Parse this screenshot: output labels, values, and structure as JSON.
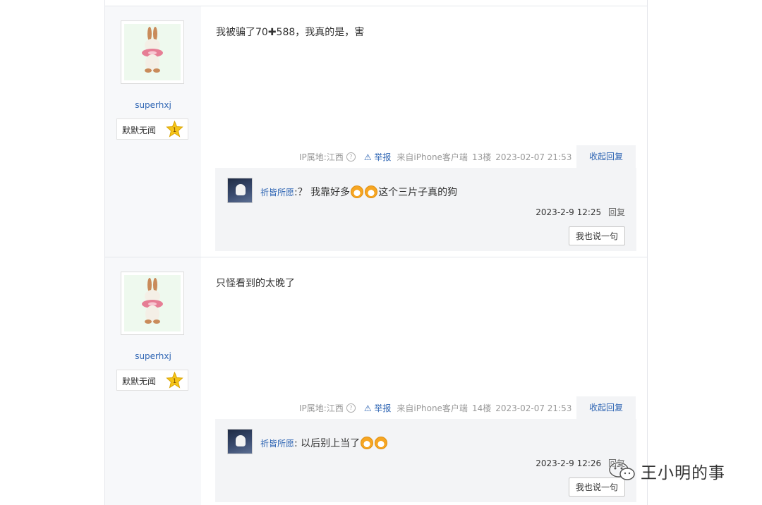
{
  "posts": [
    {
      "author": "superhxj",
      "level_name": "默默无闻",
      "level": "1",
      "content": "我被骗了70✚588，我真的是，害",
      "ip_label": "IP属地:江西",
      "report": "举报",
      "client": "来自iPhone客户端",
      "floor": "13楼",
      "time": "2023-02-07 21:53",
      "collapse": "收起回复",
      "reply": {
        "user": "祈皆所愿",
        "text_before": ":？ 我靠好多",
        "text_after": "这个三片子真的狗",
        "time": "2023-2-9 12:25",
        "reply_label": "回复"
      },
      "say_button": "我也说一句"
    },
    {
      "author": "superhxj",
      "level_name": "默默无闻",
      "level": "1",
      "content": "只怪看到的太晚了",
      "ip_label": "IP属地:江西",
      "report": "举报",
      "client": "来自iPhone客户端",
      "floor": "14楼",
      "time": "2023-02-07 21:53",
      "collapse": "收起回复",
      "reply": {
        "user": "祈皆所愿",
        "text_before": ": 以后别上当了",
        "text_after": "",
        "time": "2023-2-9 12:26",
        "reply_label": "回复"
      },
      "say_button": "我也说一句"
    }
  ],
  "watermark": "王小明的事",
  "colors": {
    "link": "#2d64b3",
    "sidebar": "#f7f8fa",
    "reply_bg": "#f3f4f6"
  }
}
